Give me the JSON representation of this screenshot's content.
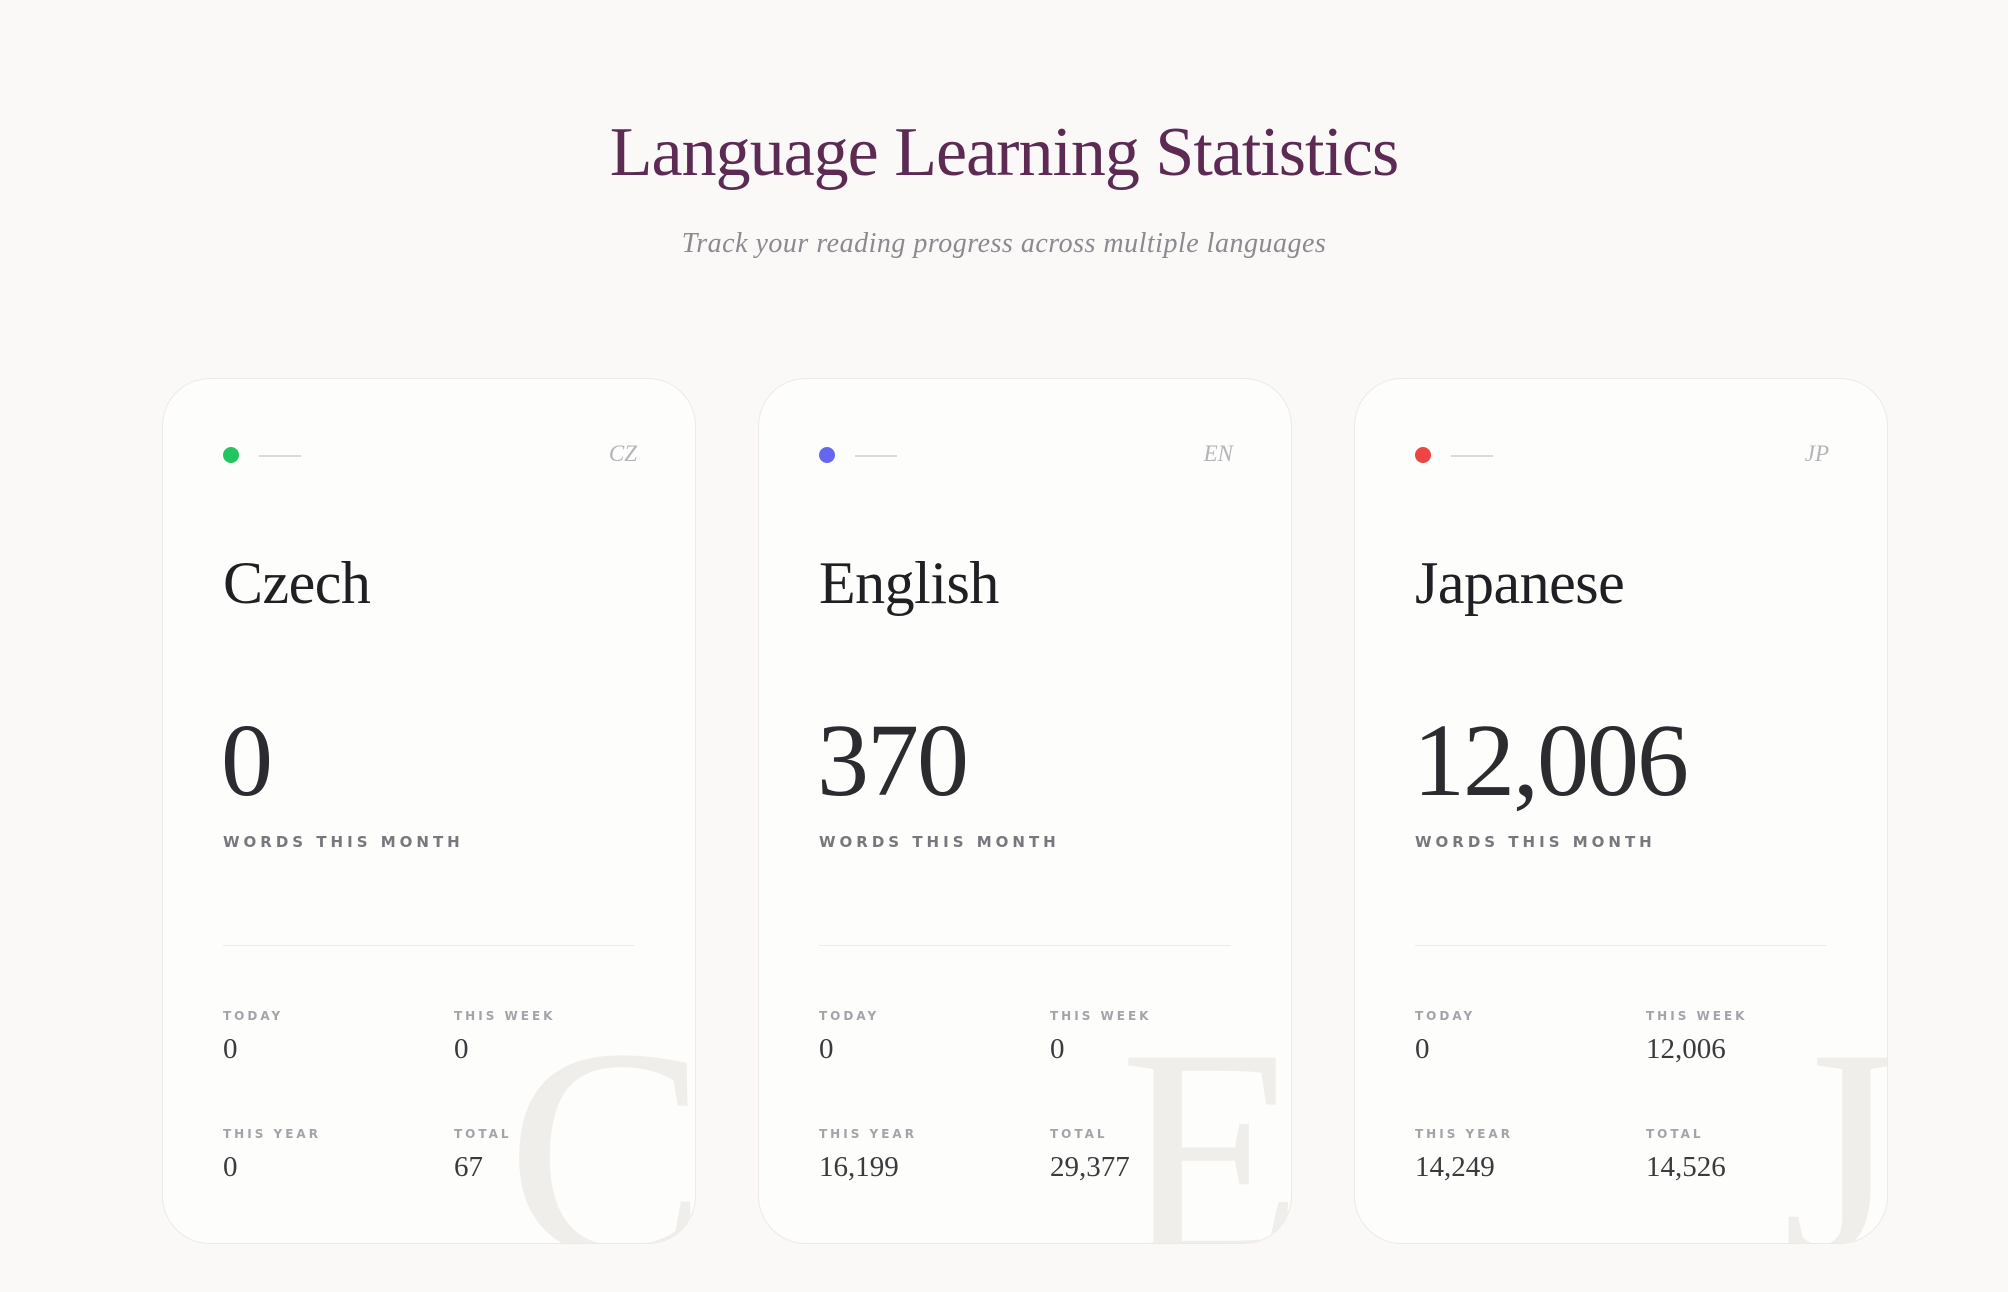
{
  "header": {
    "title": "Language Learning Statistics",
    "subtitle": "Track your reading progress across multiple languages"
  },
  "labels": {
    "words_this_month": "WORDS THIS MONTH",
    "today": "TODAY",
    "this_week": "THIS WEEK",
    "this_year": "THIS YEAR",
    "total": "TOTAL"
  },
  "cards": [
    {
      "code": "CZ",
      "name": "Czech",
      "initial": "C",
      "color": "#22c55e",
      "words_this_month": "0",
      "today": "0",
      "this_week": "0",
      "this_year": "0",
      "total": "67"
    },
    {
      "code": "EN",
      "name": "English",
      "initial": "E",
      "color": "#6366f1",
      "words_this_month": "370",
      "today": "0",
      "this_week": "0",
      "this_year": "16,199",
      "total": "29,377"
    },
    {
      "code": "JP",
      "name": "Japanese",
      "initial": "J",
      "color": "#ef4444",
      "words_this_month": "12,006",
      "today": "0",
      "this_week": "12,006",
      "this_year": "14,249",
      "total": "14,526"
    }
  ]
}
